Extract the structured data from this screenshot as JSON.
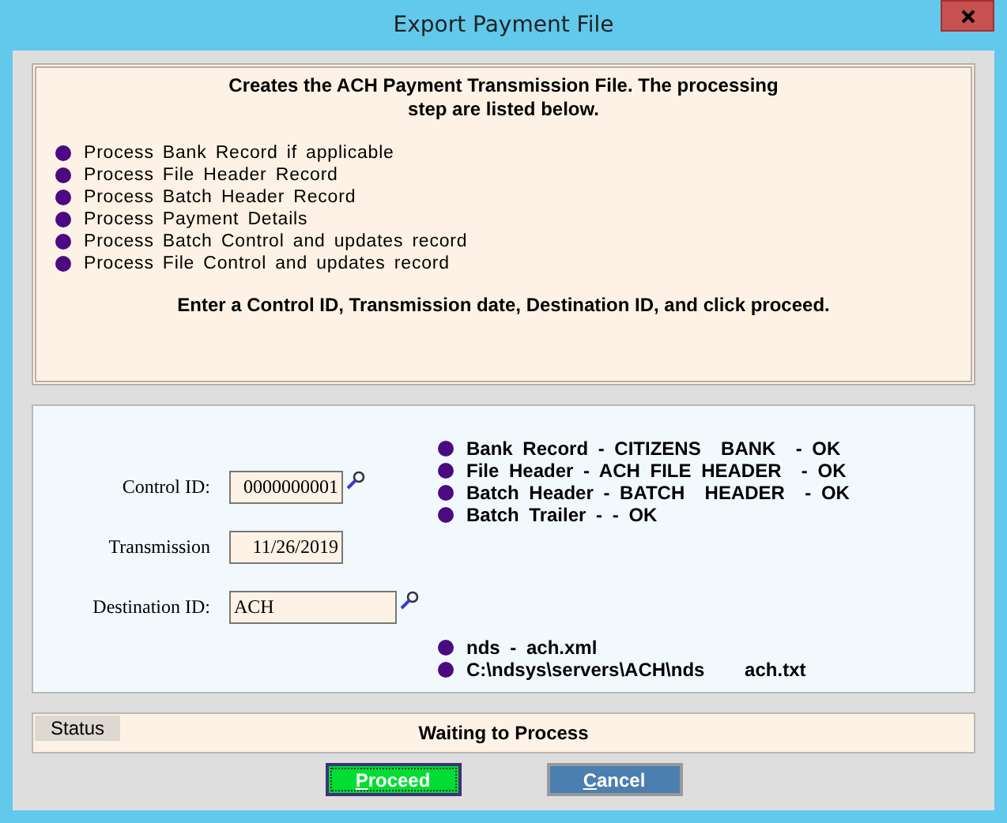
{
  "window": {
    "title": "Export Payment File"
  },
  "intro": {
    "heading": "Creates the ACH Payment Transmission File. The processing step are listed below.",
    "steps": [
      "Process Bank Record if applicable",
      "Process File Header Record",
      "Process Batch Header Record",
      "Process Payment Details",
      "Process Batch Control and updates record",
      "Process File Control and updates record"
    ],
    "instruction": "Enter a Control ID, Transmission date, Destination ID, and click proceed."
  },
  "form": {
    "fields": [
      {
        "label": "Control ID:",
        "value": "0000000001",
        "lookup": true,
        "kind": "id"
      },
      {
        "label": "Transmission",
        "value": "11/26/2019",
        "lookup": false,
        "kind": "date"
      },
      {
        "label": "Destination ID:",
        "value": "ACH",
        "lookup": true,
        "kind": "dest"
      }
    ],
    "record_results": [
      "Bank Record - CITIZENS  BANK  - OK",
      "File Header - ACH FILE HEADER  - OK",
      "Batch Header - BATCH  HEADER  - OK",
      "Batch Trailer - - OK"
    ],
    "output_files": [
      "nds - ach.xml",
      "C:\\ndsys\\servers\\ACH\\nds    ach.txt"
    ]
  },
  "status": {
    "label": "Status",
    "message": "Waiting to Process"
  },
  "buttons": [
    {
      "label": "Proceed",
      "kind": "primary"
    },
    {
      "label": "Cancel",
      "kind": "secondary"
    }
  ]
}
